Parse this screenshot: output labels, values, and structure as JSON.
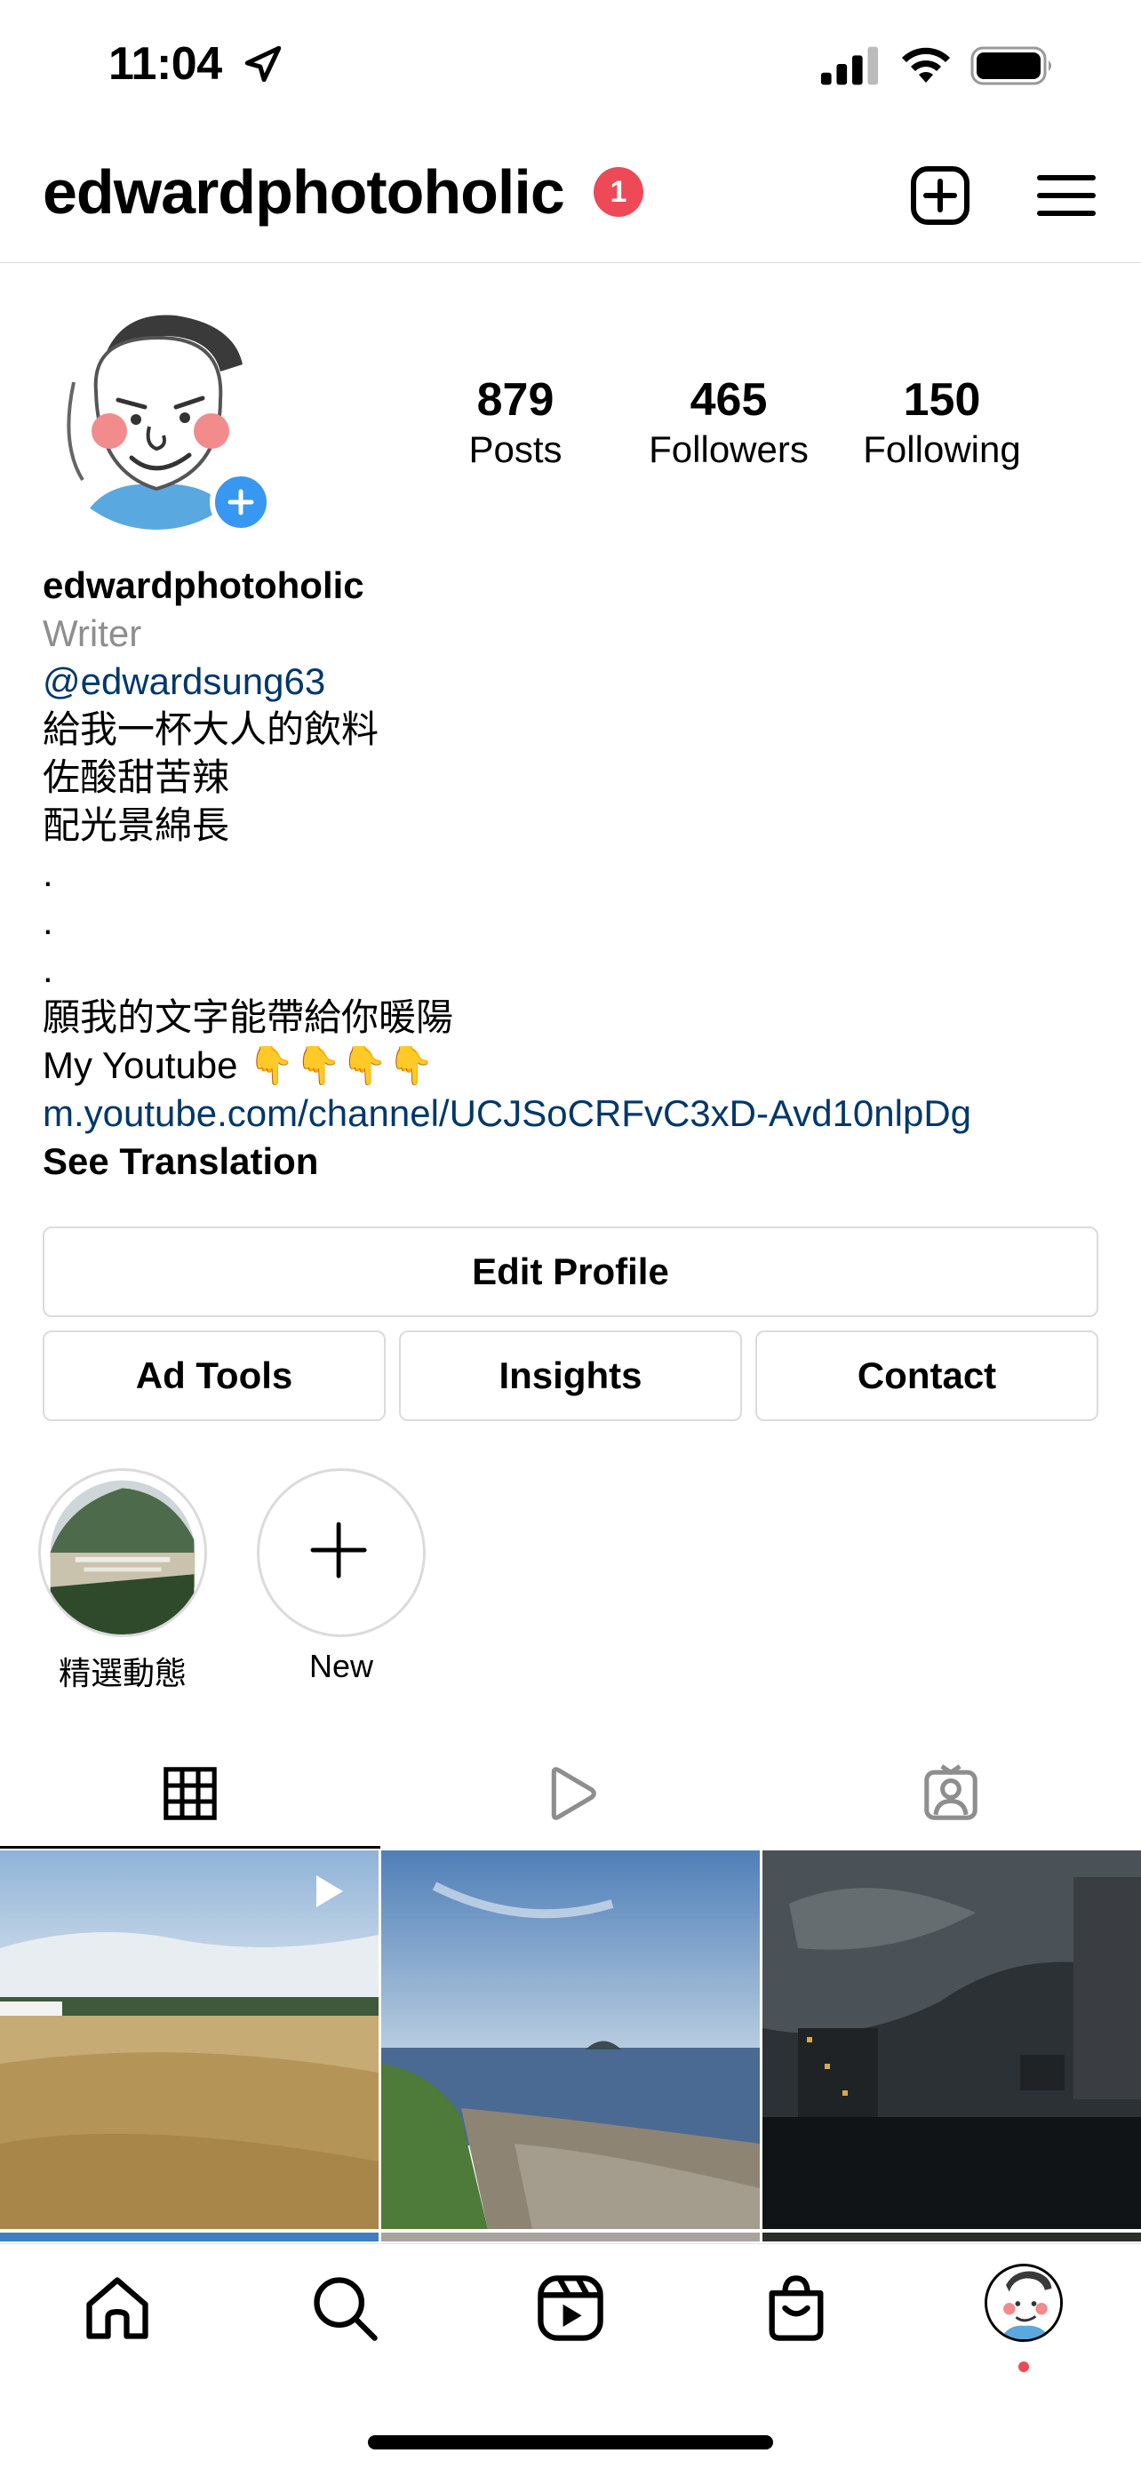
{
  "status_bar": {
    "time": "11:04"
  },
  "header": {
    "username": "edwardphotoholic",
    "notification_count": "1"
  },
  "stats": [
    {
      "value": "879",
      "label": "Posts"
    },
    {
      "value": "465",
      "label": "Followers"
    },
    {
      "value": "150",
      "label": "Following"
    }
  ],
  "bio": {
    "name": "edwardphotoholic",
    "category": "Writer",
    "mention": "@edwardsung63",
    "lines": [
      "給我一杯大人的飲料",
      "佐酸甜苦辣",
      "配光景綿長",
      ".",
      ".",
      ".",
      "願我的文字能帶給你暖陽",
      "My Youtube 👇👇👇👇"
    ],
    "link": "m.youtube.com/channel/UCJSoCRFvC3xD-Avd10nlpDg",
    "see_translation": "See Translation"
  },
  "buttons": {
    "edit_profile": "Edit Profile",
    "ad_tools": "Ad Tools",
    "insights": "Insights",
    "contact": "Contact"
  },
  "highlights": [
    {
      "label": "精選動態"
    },
    {
      "label": "New"
    }
  ],
  "tabs": [
    "grid-icon",
    "reels-icon",
    "tagged-icon"
  ],
  "nav": [
    "home-icon",
    "search-icon",
    "reels-icon",
    "shop-icon",
    "profile-avatar"
  ],
  "colors": {
    "badge": "#ed4956",
    "link": "#00376b",
    "accent_blue": "#3897f0",
    "secondary_text": "#8e8e8e"
  }
}
